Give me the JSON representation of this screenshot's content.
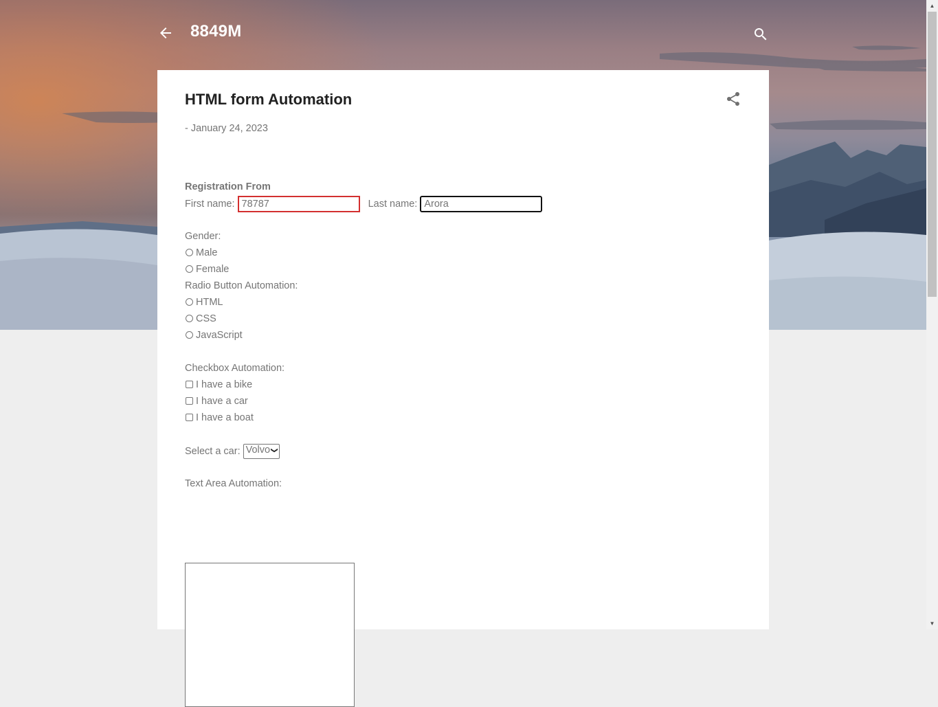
{
  "header": {
    "blog_title": "8849M",
    "back_icon": "arrow-left-icon",
    "search_icon": "search-icon"
  },
  "post": {
    "title": "HTML form Automation",
    "date_prefix": "-",
    "date": "January 24, 2023",
    "share_icon": "share-icon"
  },
  "form": {
    "heading": "Registration From",
    "first_name_label": "First name:",
    "first_name_value": "78787",
    "last_name_label": "Last name:",
    "last_name_value": "Arora",
    "gender_label": "Gender:",
    "gender_options": [
      "Male",
      "Female"
    ],
    "radio_label": "Radio Button Automation:",
    "radio_options": [
      "HTML",
      "CSS",
      "JavaScript"
    ],
    "checkbox_label": "Checkbox Automation:",
    "checkbox_options": [
      "I have a bike",
      "I have a car",
      "I have a boat"
    ],
    "select_label": "Select a car:",
    "select_value": "Volvo",
    "textarea_label": "Text Area Automation:",
    "textarea_value": ""
  },
  "colors": {
    "error_border": "#d32f2f",
    "page_background": "#eeeeee",
    "text": "#757575",
    "title": "#212121"
  }
}
